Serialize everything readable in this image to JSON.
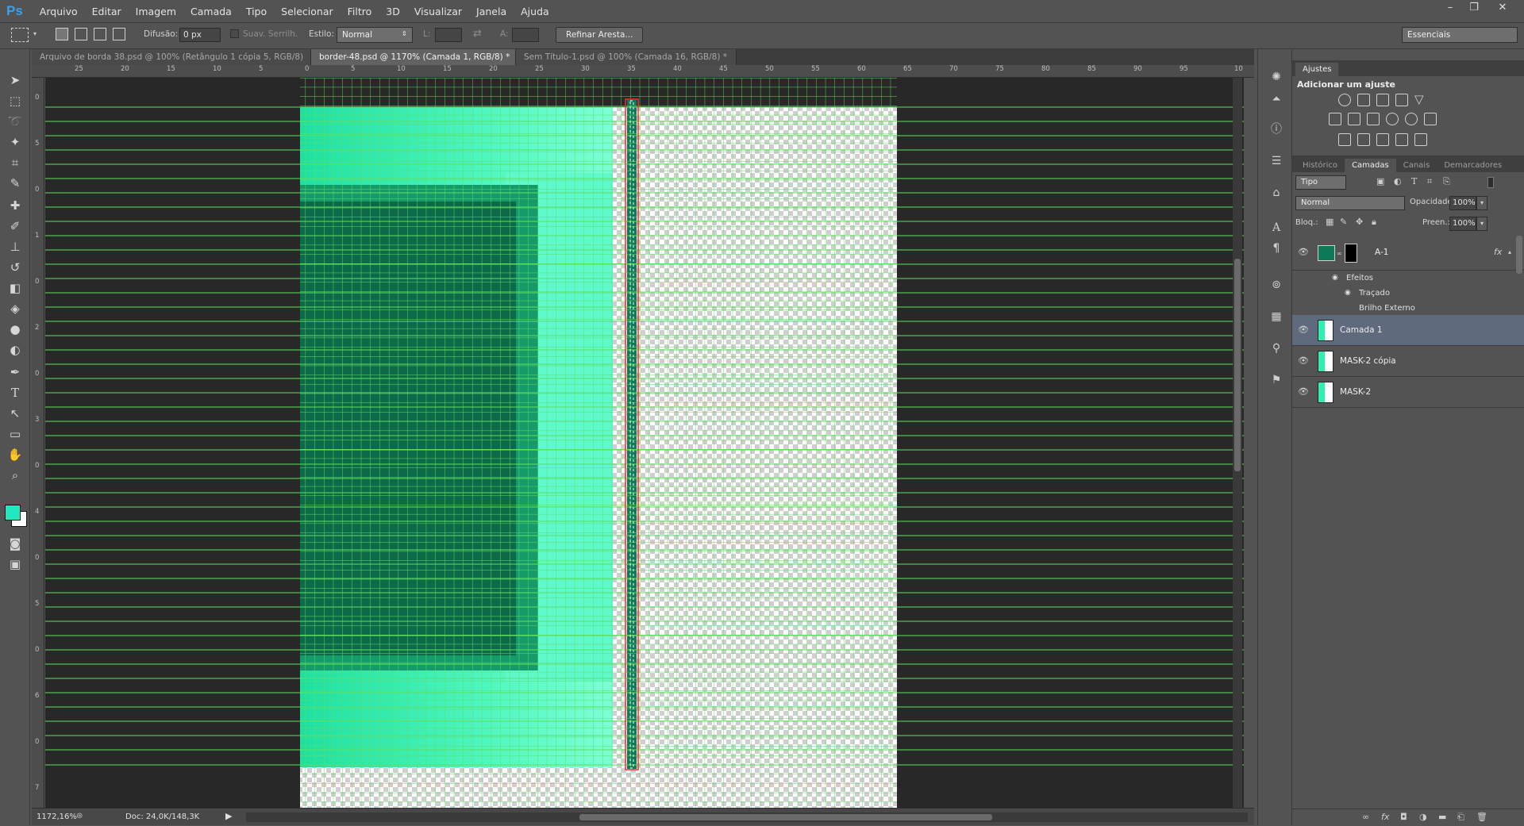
{
  "app": {
    "logo": "Ps",
    "menu": [
      "Arquivo",
      "Editar",
      "Imagem",
      "Camada",
      "Tipo",
      "Selecionar",
      "Filtro",
      "3D",
      "Visualizar",
      "Janela",
      "Ajuda"
    ],
    "window_controls": [
      "–",
      "❐",
      "✕"
    ]
  },
  "options": {
    "feather_label": "Difusão:",
    "feather_value": "0 px",
    "antialias_label": "Suav. Serrilh.",
    "style_label": "Estilo:",
    "style_value": "Normal",
    "width_label": "L:",
    "height_label": "A:",
    "refine_button": "Refinar Aresta...",
    "workspace": "Essenciais"
  },
  "tabs": [
    {
      "label": "Arquivo de borda 38.psd @ 100% (Retângulo 1 cópia 5, RGB/8)",
      "active": false
    },
    {
      "label": "border-48.psd @ 1170% (Camada 1, RGB/8) *",
      "active": true
    },
    {
      "label": "Sem Título-1.psd @ 100% (Camada 16, RGB/8) *",
      "active": false
    }
  ],
  "ruler": {
    "h": [
      "25",
      "20",
      "15",
      "10",
      "5",
      "0",
      "5",
      "10",
      "15",
      "20",
      "25",
      "30",
      "35",
      "40",
      "45",
      "50",
      "55",
      "60",
      "65",
      "70",
      "75",
      "80",
      "85",
      "90",
      "95",
      "10"
    ],
    "v": [
      "0",
      "5",
      "0",
      "1",
      "0",
      "2",
      "0",
      "3",
      "0",
      "4",
      "0",
      "5",
      "0",
      "6",
      "0",
      "7",
      "0",
      "8",
      "0"
    ]
  },
  "status": {
    "zoom": "1172,16%",
    "doc": "Doc: 24,0K/148,3K"
  },
  "colors": {
    "foreground": "#22e8c0",
    "background": "#ffffff",
    "grid": "#5ee05e",
    "selection": "#ff2a2a"
  },
  "panels": {
    "adjustments_tab": "Ajustes",
    "adjustments_title": "Adicionar um ajuste",
    "layer_tabs": [
      "Histórico",
      "Camadas",
      "Canais",
      "Demarcadores"
    ],
    "active_layer_tab": "Camadas",
    "filter_kind": "Tipo",
    "blend_mode": "Normal",
    "opacity_label": "Opacidade:",
    "opacity_value": "100%",
    "lock_label": "Bloq.:",
    "fill_label": "Preen.:",
    "fill_value": "100%"
  },
  "layers": [
    {
      "name": "A-1",
      "type": "shape",
      "fx": "fx",
      "effects_label": "Efeitos",
      "effects": [
        "Traçado",
        "Brilho Externo"
      ]
    },
    {
      "name": "Camada 1",
      "selected": true
    },
    {
      "name": "MASK-2 cópia"
    },
    {
      "name": "MASK-2"
    }
  ]
}
